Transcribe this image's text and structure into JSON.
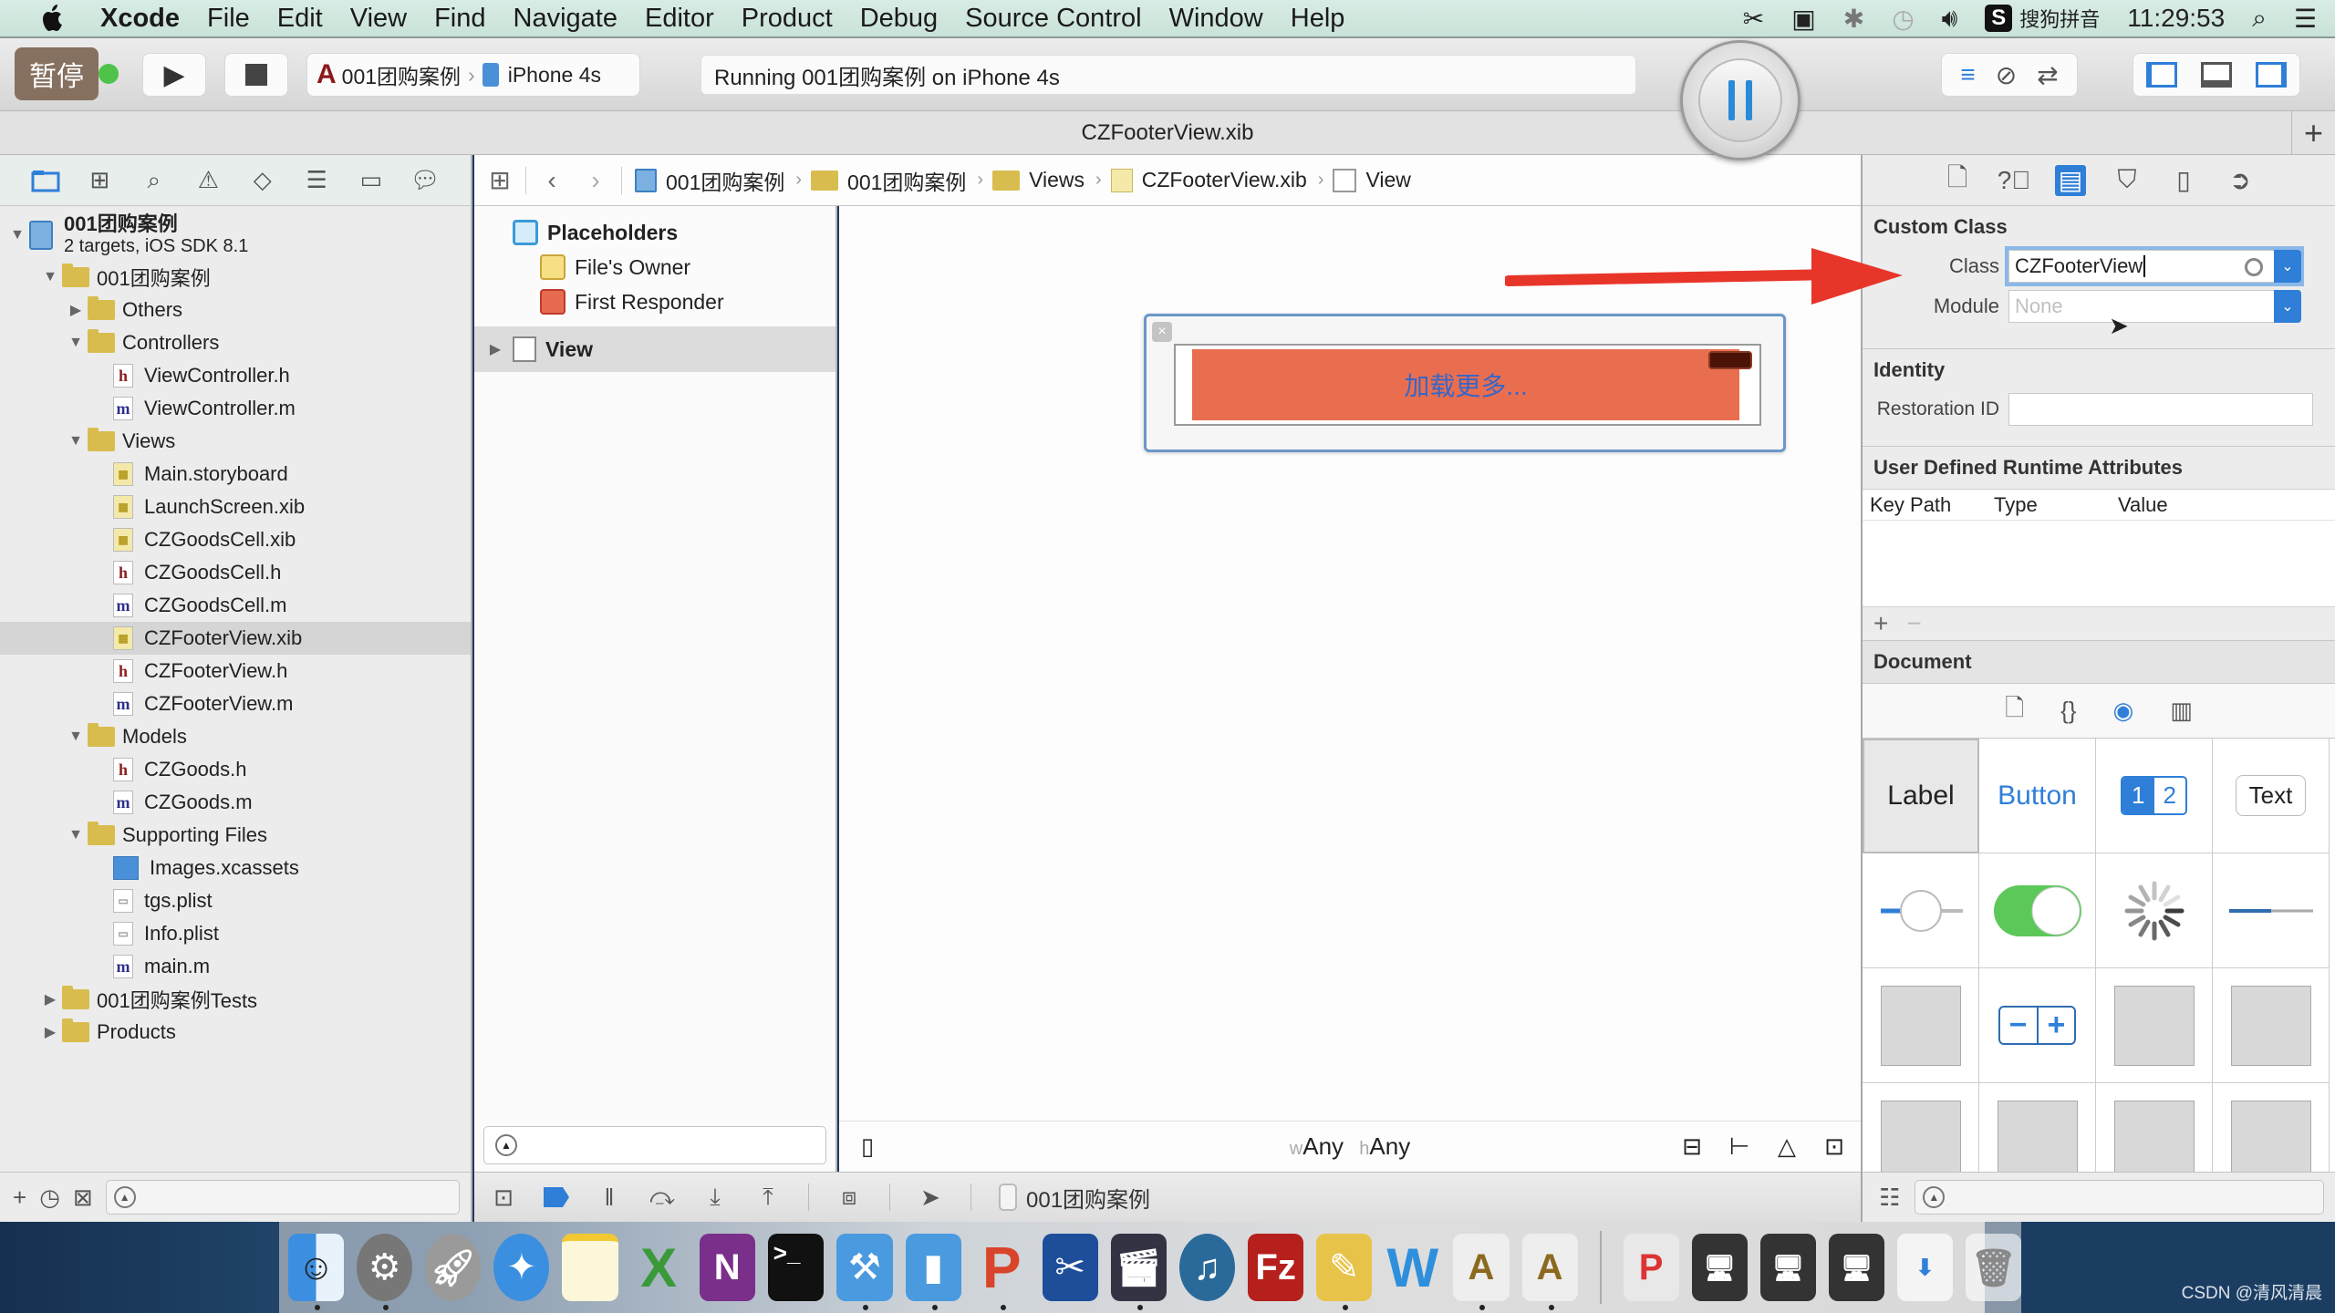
{
  "menubar": {
    "app_name": "Xcode",
    "items": [
      "File",
      "Edit",
      "View",
      "Find",
      "Navigate",
      "Editor",
      "Product",
      "Debug",
      "Source Control",
      "Window",
      "Help"
    ],
    "status_icons": [
      "scissors-icon",
      "camera-icon",
      "bluetooth-icon",
      "time-machine-icon",
      "volume-icon"
    ],
    "input_method": "搜狗拼音",
    "input_badge": "S",
    "clock": "11:29:53"
  },
  "toolbar": {
    "pause_badge": "暂停",
    "scheme": "001团购案例",
    "device": "iPhone 4s",
    "status": "Running 001团购案例 on iPhone 4s"
  },
  "tab": {
    "title": "CZFooterView.xib",
    "add_label": "+"
  },
  "navigator": {
    "project": {
      "name": "001团购案例",
      "subtitle": "2 targets, iOS SDK 8.1"
    },
    "tree": [
      {
        "label": "001团购案例",
        "type": "folder",
        "level": 1,
        "open": true
      },
      {
        "label": "Others",
        "type": "folder",
        "level": 2,
        "open": false
      },
      {
        "label": "Controllers",
        "type": "folder",
        "level": 2,
        "open": true
      },
      {
        "label": "ViewController.h",
        "type": "h",
        "level": 3
      },
      {
        "label": "ViewController.m",
        "type": "m",
        "level": 3
      },
      {
        "label": "Views",
        "type": "folder",
        "level": 2,
        "open": true
      },
      {
        "label": "Main.storyboard",
        "type": "xib",
        "level": 3
      },
      {
        "label": "LaunchScreen.xib",
        "type": "xib",
        "level": 3
      },
      {
        "label": "CZGoodsCell.xib",
        "type": "xib",
        "level": 3
      },
      {
        "label": "CZGoodsCell.h",
        "type": "h",
        "level": 3
      },
      {
        "label": "CZGoodsCell.m",
        "type": "m",
        "level": 3
      },
      {
        "label": "CZFooterView.xib",
        "type": "xib",
        "level": 3,
        "selected": true
      },
      {
        "label": "CZFooterView.h",
        "type": "h",
        "level": 3
      },
      {
        "label": "CZFooterView.m",
        "type": "m",
        "level": 3
      },
      {
        "label": "Models",
        "type": "folder",
        "level": 2,
        "open": true
      },
      {
        "label": "CZGoods.h",
        "type": "h",
        "level": 3
      },
      {
        "label": "CZGoods.m",
        "type": "m",
        "level": 3
      },
      {
        "label": "Supporting Files",
        "type": "folder",
        "level": 2,
        "open": true
      },
      {
        "label": "Images.xcassets",
        "type": "assets",
        "level": 3
      },
      {
        "label": "tgs.plist",
        "type": "plist",
        "level": 3
      },
      {
        "label": "Info.plist",
        "type": "plist",
        "level": 3
      },
      {
        "label": "main.m",
        "type": "m",
        "level": 3
      },
      {
        "label": "001团购案例Tests",
        "type": "folder",
        "level": 1,
        "open": false
      },
      {
        "label": "Products",
        "type": "folder",
        "level": 1,
        "open": false
      }
    ],
    "bottom_add": "+"
  },
  "jumpbar": {
    "crumbs": [
      {
        "label": "001团购案例",
        "icon": "proj"
      },
      {
        "label": "001团购案例",
        "icon": "fold"
      },
      {
        "label": "Views",
        "icon": "fold"
      },
      {
        "label": "CZFooterView.xib",
        "icon": "xib"
      },
      {
        "label": "View",
        "icon": "view"
      }
    ]
  },
  "outline": {
    "placeholders": "Placeholders",
    "files_owner": "File's Owner",
    "first_responder": "First Responder",
    "view": "View"
  },
  "canvas": {
    "button_title": "加载更多...",
    "size_w_prefix": "w",
    "size_w": "Any",
    "size_h_prefix": "h",
    "size_h": "Any"
  },
  "debugbar": {
    "process": "001团购案例"
  },
  "inspector": {
    "custom_class": {
      "header": "Custom Class",
      "class_label": "Class",
      "class_value": "CZFooterView",
      "module_label": "Module",
      "module_placeholder": "None"
    },
    "identity": {
      "header": "Identity",
      "restoration_label": "Restoration ID",
      "restoration_value": ""
    },
    "udra": {
      "header": "User Defined Runtime Attributes",
      "columns": [
        "Key Path",
        "Type",
        "Value"
      ],
      "add": "+",
      "remove": "−"
    },
    "document": {
      "header": "Document"
    },
    "library": {
      "objects": [
        {
          "label": "Label"
        },
        {
          "label": "Button"
        },
        {
          "label": "1",
          "label2": "2"
        },
        {
          "label": "Text"
        }
      ]
    }
  },
  "colors": {
    "accent": "#2f7fd8",
    "button_bg": "#e96e50",
    "button_text": "#3566c9",
    "arrow": "#e8352a",
    "switch_on": "#5cc85a"
  },
  "watermark": "CSDN @清风清晨"
}
